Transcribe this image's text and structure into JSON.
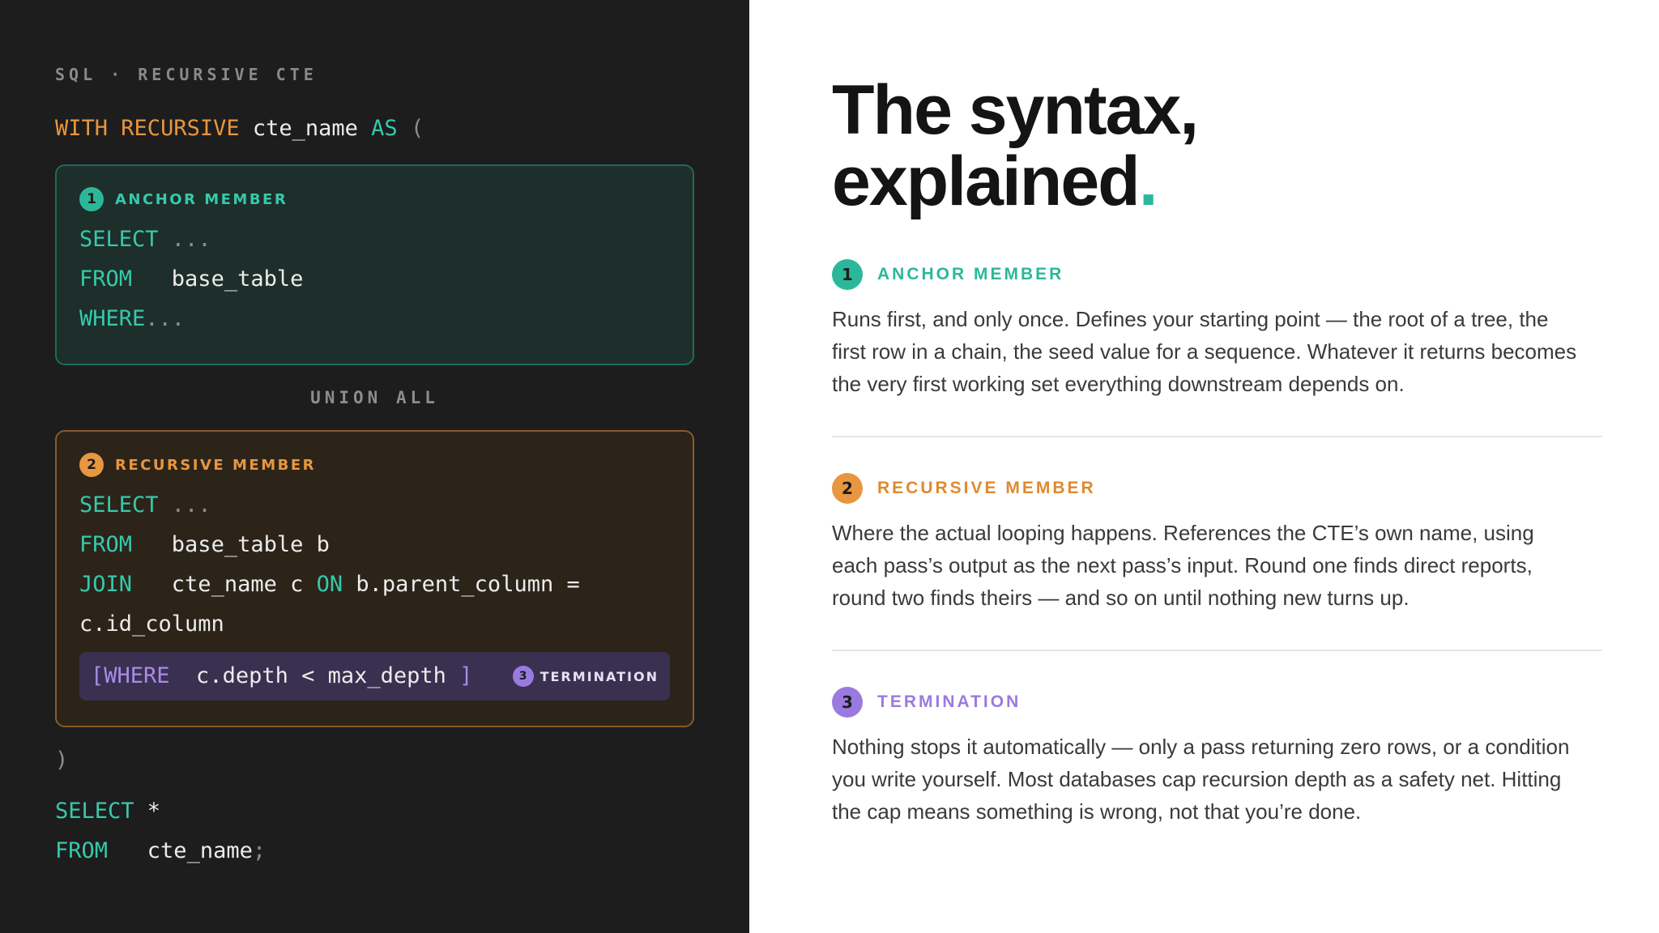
{
  "left": {
    "eyebrow": "SQL · RECURSIVE CTE",
    "header": {
      "with": "WITH",
      "recursive": "RECURSIVE",
      "name": " cte_name ",
      "as": "AS",
      "paren": " ("
    },
    "anchor": {
      "num": "1",
      "label": "ANCHOR MEMBER",
      "lines": [
        {
          "kw": "SELECT",
          "rest": " ..."
        },
        {
          "kw": "FROM",
          "rest": "   base_table"
        },
        {
          "kw": "WHERE",
          "rest": "..."
        }
      ]
    },
    "union": "UNION ALL",
    "recursive": {
      "num": "2",
      "label": "RECURSIVE MEMBER",
      "select_kw": "SELECT",
      "select_rest": " ...",
      "from_kw": "FROM",
      "from_rest": "   base_table b",
      "join_kw": "JOIN",
      "join_rest": "   cte_name c ",
      "on_kw": "ON",
      "on_rest": " b.parent_column =",
      "cont": "c.id_column",
      "term_open": "[WHERE",
      "term_expr": "  c.depth < max_depth ",
      "term_close": "]",
      "term_num": "3",
      "term_label": "TERMINATION"
    },
    "close_paren": ")",
    "final_select_kw": "SELECT",
    "final_select_rest": " *",
    "final_from_kw": "FROM",
    "final_from_rest": "   cte_name",
    "final_semicolon": ";"
  },
  "right": {
    "title_line1": "The syntax,",
    "title_line2": "explained",
    "title_dot": ".",
    "sections": [
      {
        "num": "1",
        "label": "ANCHOR MEMBER",
        "body": "Runs first, and only once. Defines your starting point — the root of a tree, the first row in a chain, the seed value for a sequence. Whatever it returns becomes the very first working set everything downstream depends on."
      },
      {
        "num": "2",
        "label": "RECURSIVE MEMBER",
        "body": "Where the actual looping happens. References the CTE’s own name, using each pass’s output as the next pass’s input. Round one finds direct reports, round two finds theirs — and so on until nothing new turns up."
      },
      {
        "num": "3",
        "label": "TERMINATION",
        "body": "Nothing stops it automatically — only a pass returning zero rows, or a condition you write yourself. Most databases cap recursion depth as a safety net. Hitting the cap means something is wrong, not that you’re done."
      }
    ]
  },
  "colors": {
    "teal": "#2bb89a",
    "orange": "#e8963f",
    "purple": "#9a7ae0",
    "dark_bg": "#1d1d1d"
  }
}
